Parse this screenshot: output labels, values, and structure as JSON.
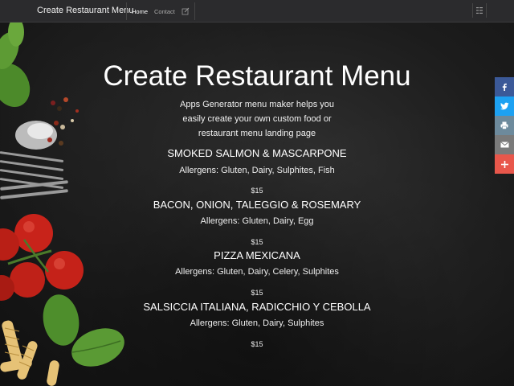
{
  "navbar": {
    "brand": "Create Restaurant Menu",
    "links": [
      {
        "label": "Home"
      },
      {
        "label": "Contact"
      }
    ]
  },
  "hero": {
    "title": "Create Restaurant Menu",
    "subtitle": "Apps Generator menu maker helps you easily create your own custom food or restaurant menu landing page"
  },
  "menu": [
    {
      "name": "SMOKED SALMON & MASCARPONE",
      "allergens": "Allergens: Gluten, Dairy, Sulphites, Fish",
      "price": "$15"
    },
    {
      "name": "BACON, ONION, TALEGGIO & ROSEMARY",
      "allergens": "Allergens: Gluten, Dairy, Egg",
      "price": "$15"
    },
    {
      "name": "PIZZA MEXICANA",
      "allergens": "Allergens: Gluten, Dairy, Celery, Sulphites",
      "price": "$15"
    },
    {
      "name": "SALSICCIA ITALIANA, RADICCHIO Y CEBOLLA",
      "allergens": "Allergens: Gluten, Dairy, Sulphites",
      "price": "$15"
    }
  ],
  "share": [
    {
      "icon": "facebook-icon",
      "color": "#3b5998"
    },
    {
      "icon": "twitter-icon",
      "color": "#1da1f2"
    },
    {
      "icon": "print-icon",
      "color": "#6d8a9c"
    },
    {
      "icon": "email-icon",
      "color": "#7a7a7a"
    },
    {
      "icon": "plus-icon",
      "color": "#e8574b"
    }
  ]
}
